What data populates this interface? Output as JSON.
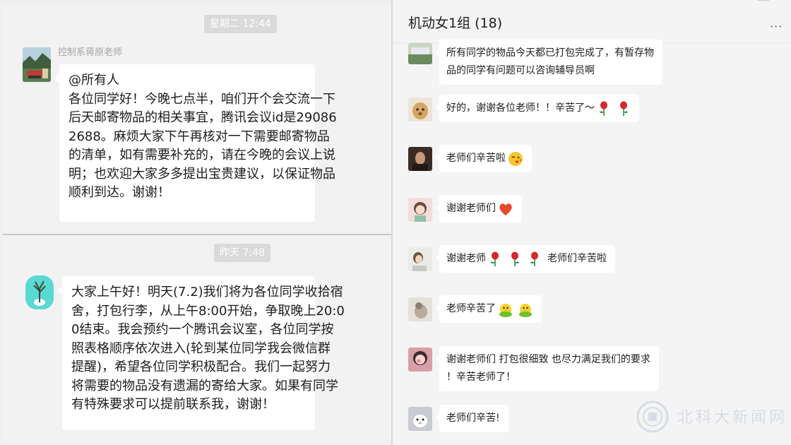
{
  "left": {
    "top_panel": {
      "timestamp": "星期二 12:44",
      "sender": "控制系蒋原老师",
      "lines": [
        "@所有人",
        "各位同学好！今晚七点半，咱们开个会交流一下",
        "后天邮寄物品的相关事宜，腾讯会议id是29086",
        "2688。麻烦大家下午再核对一下需要邮寄物品",
        "的清单，如有需要补充的，请在今晚的会议上说",
        "明；也欢迎大家多多提出宝贵建议，以保证物品",
        "顺利到达。谢谢！"
      ]
    },
    "bottom_panel": {
      "timestamp": "昨天 7:48",
      "lines": [
        "大家上午好！明天(7.2)我们将为各位同学收拾宿",
        "舍，打包行李，从上午8:00开始，争取晚上20:0",
        "0结束。我会预约一个腾讯会议室，各位同学按",
        "照表格顺序依次进入(轮到某位同学我会微信群",
        "提醒)，希望各位同学积极配合。我们一起努力",
        "将需要的物品没有遗漏的寄给大家。如果有同学",
        "有特殊要求可以提前联系我，谢谢！"
      ]
    }
  },
  "right": {
    "title": "机动女1组 (18)",
    "more": "···",
    "messages": [
      {
        "lines": [
          "所有同学的物品今天都已打包完成了，有暂存物",
          "品的同学有问题可以咨询辅导员啊"
        ]
      },
      {
        "text": "好的，谢谢各位老师！！辛苦了～",
        "emoji": [
          "rose-icon",
          "rose-icon"
        ]
      },
      {
        "text": "老师们辛苦啦",
        "emoji": [
          "kiss-emoji-icon"
        ]
      },
      {
        "text": "谢谢老师们",
        "emoji": [
          "heart-icon"
        ]
      },
      {
        "text": "谢谢老师",
        "emoji": [
          "rose-icon",
          "rose-icon",
          "rose-icon"
        ],
        "text_after": "老师们辛苦啦"
      },
      {
        "text": "老师辛苦了",
        "emoji": [
          "chick-icon",
          "chick-icon"
        ]
      },
      {
        "lines": [
          "谢谢老师们 打包很细致 也尽力满足我们的要求",
          "！辛苦老师了！"
        ]
      },
      {
        "text": "老师们辛苦!"
      }
    ]
  },
  "watermark": "北科大新闻网",
  "colors": {
    "bubble": "#ffffff",
    "panel": "#f2f2f2",
    "timestamp_pill": "#dadada",
    "rose": "#d8262d",
    "heart": "#e8492c",
    "chick": "#6cc22a"
  }
}
